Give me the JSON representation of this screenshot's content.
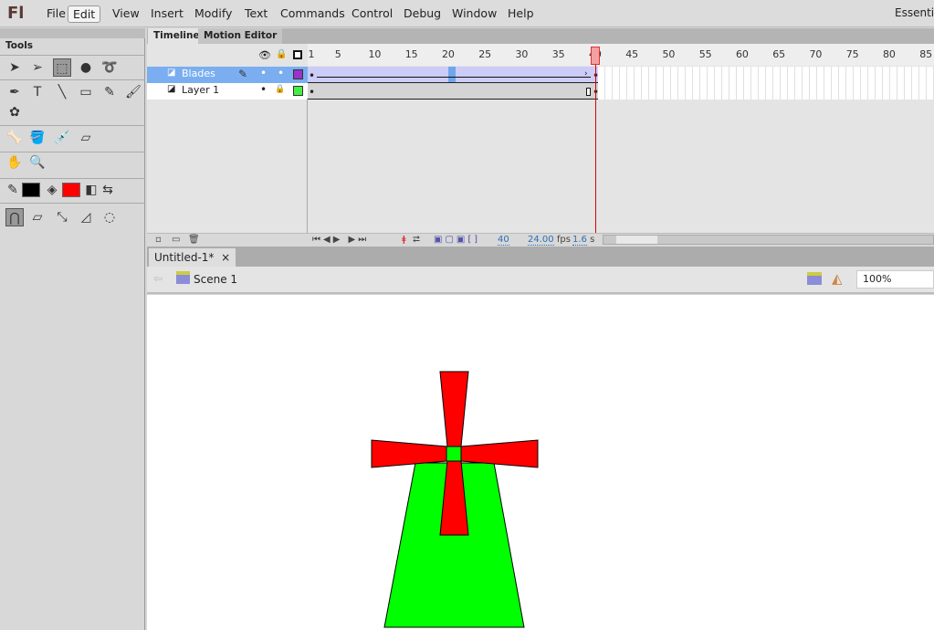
{
  "app": {
    "logo": "Fl",
    "workspace": "Essentials"
  },
  "menu": [
    "File",
    "Edit",
    "View",
    "Insert",
    "Modify",
    "Text",
    "Commands",
    "Control",
    "Debug",
    "Window",
    "Help"
  ],
  "menu_selected": "Edit",
  "tools": {
    "title": "Tools",
    "stroke_color": "#000000",
    "fill_color": "#ff0000"
  },
  "timeline": {
    "tabs": [
      "Timeline",
      "Motion Editor"
    ],
    "ruler": [
      "1",
      "5",
      "10",
      "15",
      "20",
      "25",
      "30",
      "35",
      "40",
      "45",
      "50",
      "55",
      "60",
      "65",
      "70",
      "75",
      "80",
      "85"
    ],
    "current_frame": 40,
    "layers": [
      {
        "name": "Blades",
        "color": "#9933cc",
        "selected": true,
        "tween_start": 1,
        "tween_end": 40
      },
      {
        "name": "Layer 1",
        "color": "#44ee44",
        "selected": false,
        "locked": true,
        "keyframe": 40
      }
    ],
    "status": {
      "frame": "40",
      "fps": "24.00",
      "fps_unit": "fps",
      "time": "1.6",
      "time_unit": "s"
    }
  },
  "document": {
    "tab": "Untitled-1*",
    "close": "×",
    "scene": "Scene 1",
    "zoom": "100%"
  },
  "stage": {
    "tower_color": "#00ff00",
    "blades_color": "#ff0000"
  }
}
